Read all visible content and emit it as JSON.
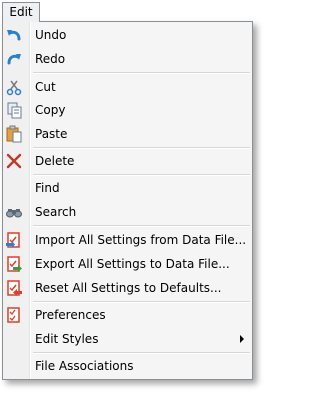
{
  "menubar": {
    "title": "Edit"
  },
  "menu": {
    "undo": "Undo",
    "redo": "Redo",
    "cut": "Cut",
    "copy": "Copy",
    "paste": "Paste",
    "delete": "Delete",
    "find": "Find",
    "search": "Search",
    "import": "Import All Settings from Data File...",
    "export": "Export All Settings to Data File...",
    "reset": "Reset All Settings to Defaults...",
    "preferences": "Preferences",
    "edit_styles": "Edit Styles",
    "file_associations": "File Associations"
  },
  "icons": {
    "undo": "undo-icon",
    "redo": "redo-icon",
    "cut": "cut-icon",
    "copy": "copy-icon",
    "paste": "paste-icon",
    "delete": "delete-icon",
    "search": "binoculars-icon",
    "import": "import-settings-icon",
    "export": "export-settings-icon",
    "reset": "reset-settings-icon",
    "preferences": "preferences-icon",
    "submenu": "chevron-right-icon"
  },
  "colors": {
    "menu_bg": "#f5f5f5",
    "border": "#8a8f96",
    "arrow_blue": "#2b7fd0",
    "delete_red": "#c0392b",
    "checklist_red": "#d9412c",
    "import_green": "#3f9a3c"
  }
}
